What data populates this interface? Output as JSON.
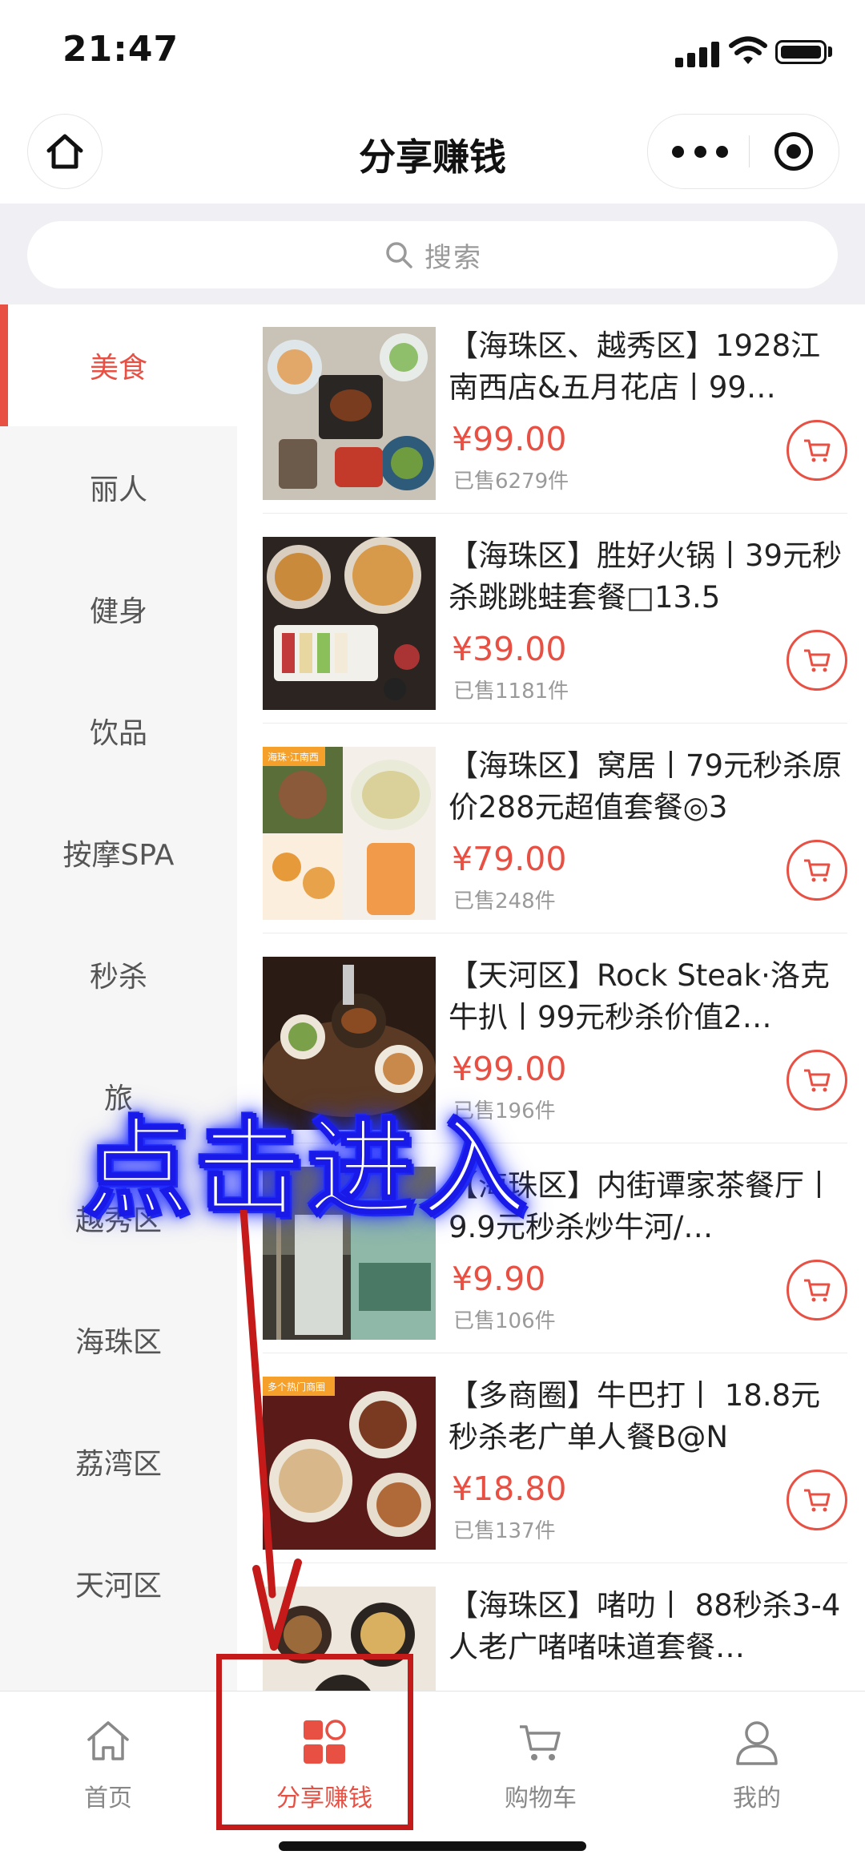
{
  "status_bar": {
    "time": "21:47"
  },
  "nav": {
    "title": "分享赚钱"
  },
  "search": {
    "placeholder": "搜索"
  },
  "sidebar": {
    "categories": [
      "美食",
      "丽人",
      "健身",
      "饮品",
      "按摩SPA",
      "秒杀",
      "旅",
      "越秀区",
      "海珠区",
      "荔湾区",
      "天河区"
    ],
    "active": "美食"
  },
  "products": [
    {
      "title": "【海珠区、越秀区】1928江南西店&五月花店丨99…",
      "price": "¥99.00",
      "sold": "已售6279件"
    },
    {
      "title": "【海珠区】胜好火锅丨39元秒杀跳跳蛙套餐□13.5",
      "price": "¥39.00",
      "sold": "已售1181件"
    },
    {
      "title": "【海珠区】窝居丨79元秒杀原价288元超值套餐◎3",
      "price": "¥79.00",
      "sold": "已售248件"
    },
    {
      "title": "【天河区】Rock Steak·洛克牛扒丨99元秒杀价值2…",
      "price": "¥99.00",
      "sold": "已售196件"
    },
    {
      "title": "【海珠区】内街谭家茶餐厅丨9.9元秒杀炒牛河/…",
      "price": "¥9.90",
      "sold": "已售106件"
    },
    {
      "title": "【多商圈】牛巴打丨 18.8元秒杀老广单人餐B@N",
      "price": "¥18.80",
      "sold": "已售137件"
    },
    {
      "title": "【海珠区】啫叻丨 88秒杀3-4人老广啫啫味道套餐…",
      "price": "",
      "sold": ""
    }
  ],
  "thumb_badges": {
    "item3": "海珠·江南西",
    "item6": "多个热门商圈"
  },
  "tabbar": [
    {
      "label": "首页",
      "icon": "home-icon"
    },
    {
      "label": "分享赚钱",
      "icon": "share-earn-icon"
    },
    {
      "label": "购物车",
      "icon": "cart-icon"
    },
    {
      "label": "我的",
      "icon": "user-icon"
    }
  ],
  "overlay": {
    "text": "点击进入"
  },
  "colors": {
    "accent": "#e85044",
    "annotation_red": "#c51a1a",
    "annotation_blue": "#1a1ae8"
  }
}
